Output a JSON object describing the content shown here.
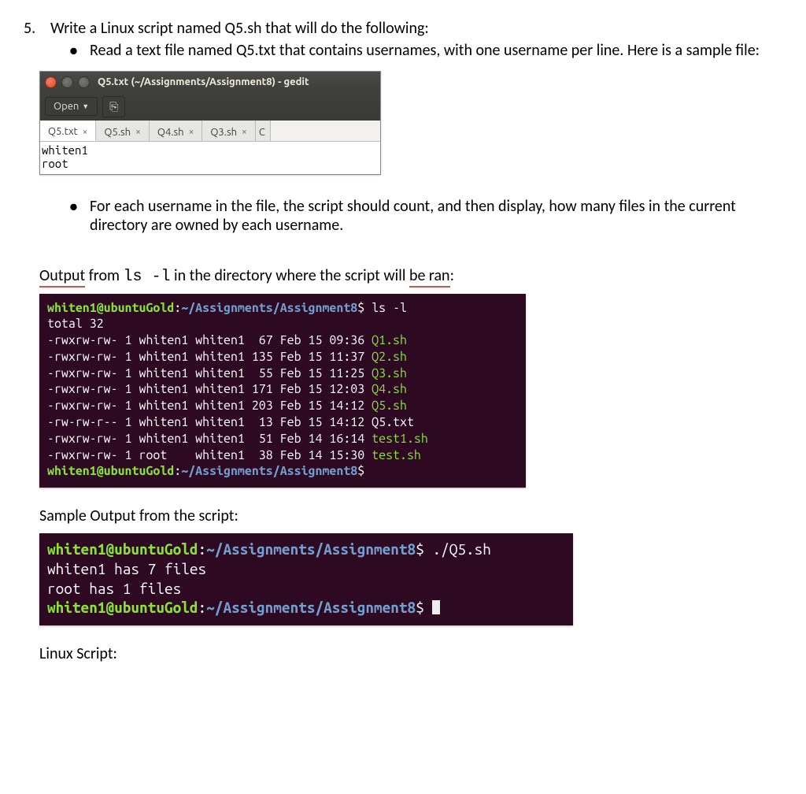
{
  "question": {
    "number": "5.",
    "text": "Write a Linux script named Q5.sh that will do the following:",
    "bullet1": "Read a text file named Q5.txt that contains usernames, with one username per line. Here is a sample file:",
    "bullet2": "For each username in the file, the script should count, and then display, how many files in the current directory are owned by each username."
  },
  "gedit": {
    "title": "Q5.txt (~/Assignments/Assignment8) - gedit",
    "open_label": "Open",
    "new_file_icon": "⎘",
    "tabs": [
      "Q5.txt",
      "Q5.sh",
      "Q4.sh",
      "Q3.sh"
    ],
    "active_tab_index": 0,
    "content_lines": [
      "whiten1",
      "root"
    ]
  },
  "output_label_pre": "Output",
  "output_label_mid1": " from ",
  "output_cmd": "ls  -l",
  "output_label_mid2": " in the directory where the script will ",
  "output_label_underline2": "be ran",
  "output_label_end": ":",
  "term1": {
    "user": "whiten1@ubuntuGold",
    "path": "~/Assignments/Assignment8",
    "cmd": "ls -l",
    "total": "total 32",
    "rows": [
      {
        "perm": "-rwxrw-rw-",
        "n": "1",
        "own": "whiten1",
        "grp": "whiten1",
        "size": " 67",
        "date": "Feb 15 09:36",
        "file": "Q1.sh",
        "exec": true
      },
      {
        "perm": "-rwxrw-rw-",
        "n": "1",
        "own": "whiten1",
        "grp": "whiten1",
        "size": "135",
        "date": "Feb 15 11:37",
        "file": "Q2.sh",
        "exec": true
      },
      {
        "perm": "-rwxrw-rw-",
        "n": "1",
        "own": "whiten1",
        "grp": "whiten1",
        "size": " 55",
        "date": "Feb 15 11:25",
        "file": "Q3.sh",
        "exec": true
      },
      {
        "perm": "-rwxrw-rw-",
        "n": "1",
        "own": "whiten1",
        "grp": "whiten1",
        "size": "171",
        "date": "Feb 15 12:03",
        "file": "Q4.sh",
        "exec": true
      },
      {
        "perm": "-rwxrw-rw-",
        "n": "1",
        "own": "whiten1",
        "grp": "whiten1",
        "size": "203",
        "date": "Feb 15 14:12",
        "file": "Q5.sh",
        "exec": true
      },
      {
        "perm": "-rw-rw-r--",
        "n": "1",
        "own": "whiten1",
        "grp": "whiten1",
        "size": " 13",
        "date": "Feb 15 14:12",
        "file": "Q5.txt",
        "exec": false
      },
      {
        "perm": "-rwxrw-rw-",
        "n": "1",
        "own": "whiten1",
        "grp": "whiten1",
        "size": " 51",
        "date": "Feb 14 16:14",
        "file": "test1.sh",
        "exec": true
      },
      {
        "perm": "-rwxrw-rw-",
        "n": "1",
        "own": "root   ",
        "grp": "whiten1",
        "size": " 38",
        "date": "Feb 14 15:30",
        "file": "test.sh",
        "exec": true
      }
    ]
  },
  "sample_label": "Sample Output from the script:",
  "term2": {
    "user": "whiten1@ubuntuGold",
    "path": "~/Assignments/Assignment8",
    "cmd": "./Q5.sh",
    "lines": [
      "whiten1 has 7 files",
      "root has 1 files"
    ]
  },
  "footer_label": "Linux Script:"
}
